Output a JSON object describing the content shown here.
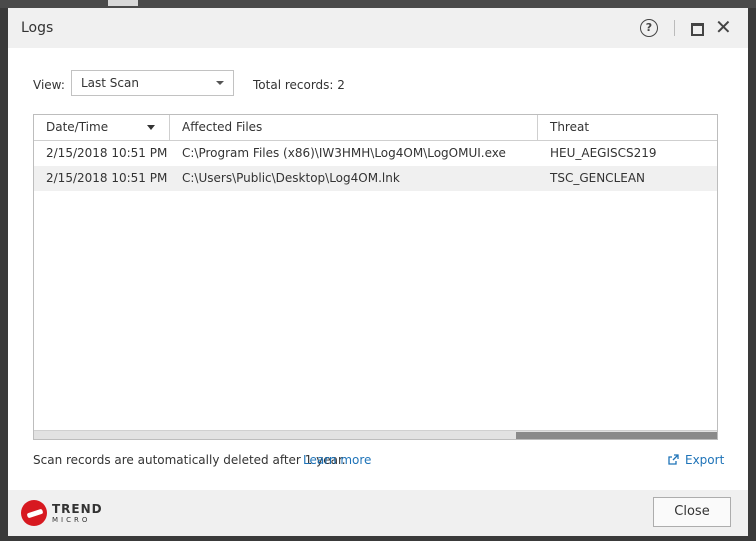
{
  "window": {
    "title": "Logs"
  },
  "filter": {
    "view_label": "View:",
    "view_value": "Last Scan",
    "total_records": "Total records: 2"
  },
  "table": {
    "columns": [
      "Date/Time",
      "Affected Files",
      "Threat"
    ],
    "rows": [
      {
        "datetime": "2/15/2018 10:51 PM",
        "file": "C:\\Program Files (x86)\\IW3HMH\\Log4OM\\LogOMUI.exe",
        "threat": "HEU_AEGISCS219"
      },
      {
        "datetime": "2/15/2018 10:51 PM",
        "file": "C:\\Users\\Public\\Desktop\\Log4OM.lnk",
        "threat": "TSC_GENCLEAN"
      }
    ]
  },
  "footer_note": {
    "text": "Scan records are automatically deleted after 1 year.",
    "link": "Learn more"
  },
  "export_label": "Export",
  "brand": {
    "name_top": "TREND",
    "name_bottom": "MICRO",
    "color": "#d71920"
  },
  "close_label": "Close",
  "colors": {
    "link": "#1e73b8",
    "alt_row": "#f0f0f0"
  }
}
